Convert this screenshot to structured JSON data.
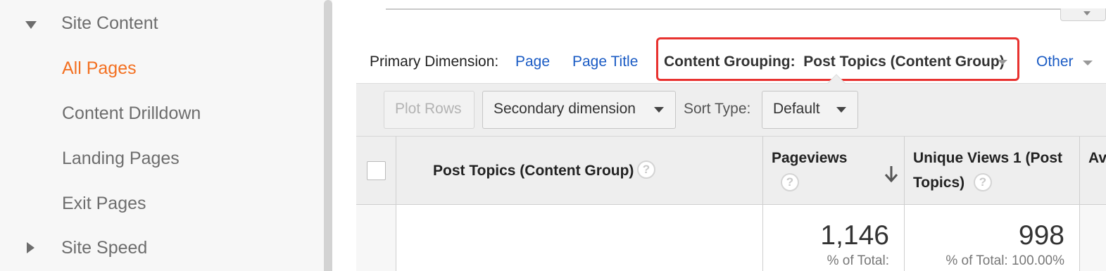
{
  "sidebar": {
    "section": {
      "label": "Site Content",
      "icon": "triangle-down-icon"
    },
    "items": [
      {
        "label": "All Pages",
        "active": true
      },
      {
        "label": "Content Drilldown",
        "active": false
      },
      {
        "label": "Landing Pages",
        "active": false
      },
      {
        "label": "Exit Pages",
        "active": false
      }
    ],
    "next_section": {
      "label": "Site Speed",
      "icon": "triangle-right-icon"
    }
  },
  "dimensions": {
    "primary_label": "Primary Dimension:",
    "page": "Page",
    "page_title": "Page Title",
    "content_grouping": "Content Grouping:  Post Topics (Content Group)",
    "other": "Other"
  },
  "toolbar": {
    "plot_rows": "Plot Rows",
    "secondary_dimension": "Secondary dimension",
    "sort_type_label": "Sort Type:",
    "sort_type_value": "Default"
  },
  "table": {
    "columns": {
      "content_group": "Post Topics (Content Group)",
      "pageviews": "Pageviews",
      "unique_views_line1": "Unique Views 1 (Post",
      "unique_views_line2": "Topics)",
      "next_partial": "Av"
    },
    "totals": {
      "pageviews": "1,146",
      "pageviews_pct": "% of Total:",
      "unique_views": "998",
      "unique_views_pct": "% of Total: 100.00%"
    }
  },
  "help_glyph": "?",
  "colors": {
    "active": "#f37021",
    "link": "#1a5bc4",
    "highlight_border": "#e8322f"
  }
}
